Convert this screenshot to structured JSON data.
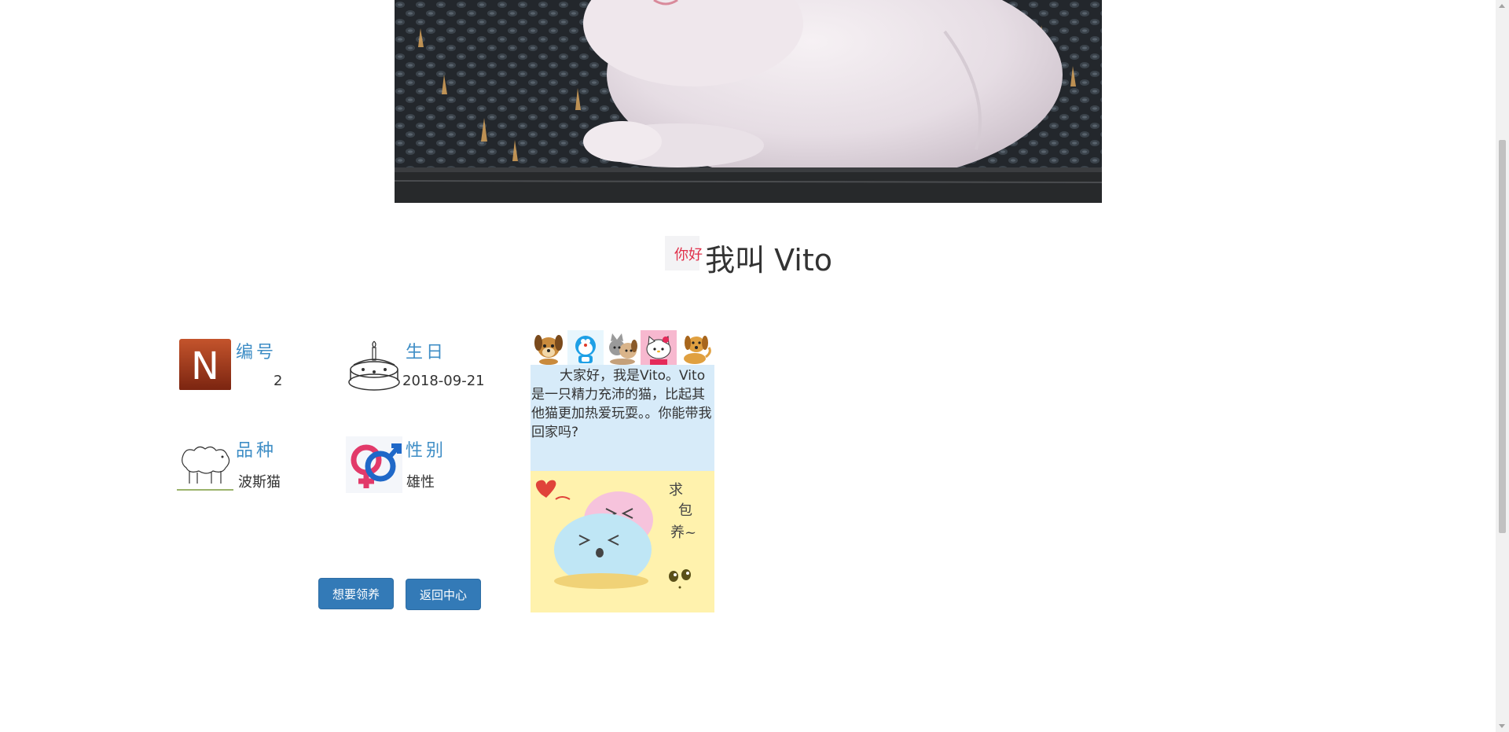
{
  "hero": {
    "icon": "white-kitten-photo"
  },
  "title": {
    "hello_icon_text": "你好",
    "text": "我叫 Vito"
  },
  "info": {
    "number": {
      "label": "编号",
      "value": "2",
      "icon": "letter-n-icon"
    },
    "birthday": {
      "label": "生日",
      "value": "2018-09-21",
      "icon": "cake-icon"
    },
    "breed": {
      "label": "品种",
      "value": "波斯猫",
      "icon": "sheep-sketch-icon"
    },
    "gender": {
      "label": "性别",
      "value": "雄性",
      "icon": "gender-symbols-icon"
    }
  },
  "buttons": {
    "adopt": "想要领养",
    "back": "返回中心"
  },
  "story": {
    "text": "大家好，我是Vito。Vito是一只精力充沛的猫，比起其他猫更加热爱玩耍。。你能带我回家吗?",
    "emoji_icons": [
      "puppy-icon",
      "doraemon-icon",
      "cat-dog-icon",
      "hello-kitty-icon",
      "dog-icon"
    ],
    "picture_caption": "求包养~",
    "picture_icon": "mochi-cartoon-icon"
  },
  "colors": {
    "label_blue": "#3f8ec6",
    "button_blue": "#337ab7",
    "story_bg": "#d7ebf9",
    "picture_bg": "#fff2ad"
  }
}
